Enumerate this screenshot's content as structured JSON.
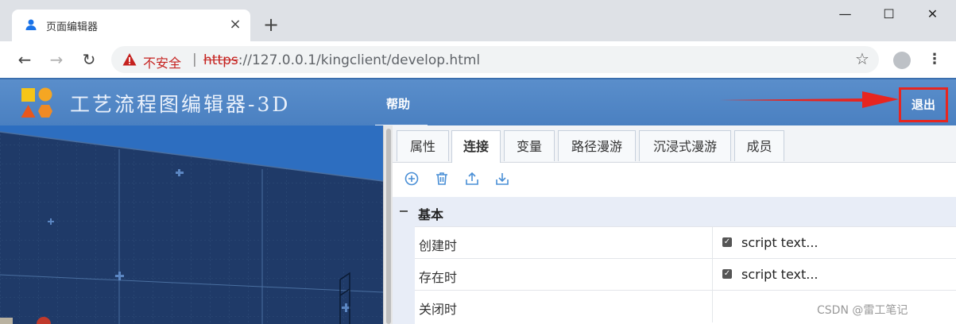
{
  "browser": {
    "tab_title": "页面编辑器",
    "tab_icon": "person-icon",
    "new_tab_label": "+",
    "close_tab_label": "×",
    "window_controls": [
      "—",
      "☐",
      "✕"
    ],
    "security_label": "不安全",
    "separator": "|",
    "url_scheme": "https",
    "url_rest": "://127.0.0.1/kingclient/develop.html",
    "accent_color": "#c5221f"
  },
  "app": {
    "title": "工艺流程图编辑器-3D",
    "help_label": "帮助",
    "logout_label": "退出",
    "header_color": "#5a8ecb",
    "highlight_color": "#e8251f"
  },
  "panel": {
    "tabs": [
      {
        "label": "属性",
        "active": false
      },
      {
        "label": "连接",
        "active": true
      },
      {
        "label": "变量",
        "active": false
      },
      {
        "label": "路径漫游",
        "active": false
      },
      {
        "label": "沉浸式漫游",
        "active": false
      },
      {
        "label": "成员",
        "active": false
      }
    ],
    "toolbar_icons": [
      "add-circle-icon",
      "trash-icon",
      "upload-icon",
      "download-icon"
    ],
    "section": {
      "title": "基本",
      "expanded": true
    },
    "rows": [
      {
        "label": "创建时",
        "checked": true,
        "value": "script text..."
      },
      {
        "label": "存在时",
        "checked": true,
        "value": "script text..."
      },
      {
        "label": "关闭时",
        "checked": false,
        "value": ""
      }
    ]
  },
  "watermark": "CSDN @雷工笔记"
}
